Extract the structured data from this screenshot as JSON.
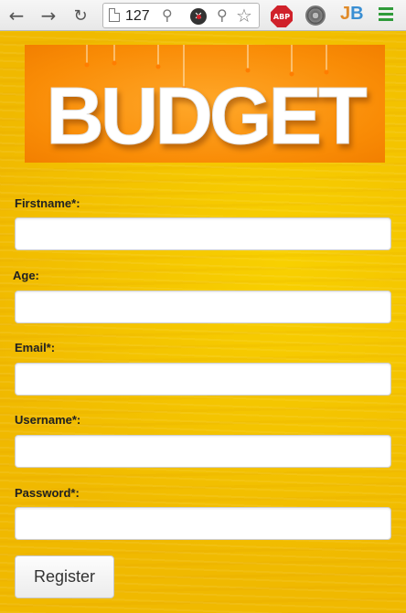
{
  "browser": {
    "address_text": "127",
    "abp_label": "ABP",
    "ext_jb_j": "J",
    "ext_jb_b": "B"
  },
  "banner": {
    "title": "BUDGET"
  },
  "form": {
    "fields": [
      {
        "label": "Firstname*:",
        "value": ""
      },
      {
        "label": "Age:",
        "value": ""
      },
      {
        "label": "Email*:",
        "value": ""
      },
      {
        "label": "Username*:",
        "value": ""
      },
      {
        "label": "Password*:",
        "value": ""
      }
    ],
    "submit_label": "Register"
  },
  "colors": {
    "page_background": "#f2c400",
    "banner_orange": "#f98c06",
    "abp_red": "#d0212a",
    "menu_green": "#2f9b3a"
  }
}
